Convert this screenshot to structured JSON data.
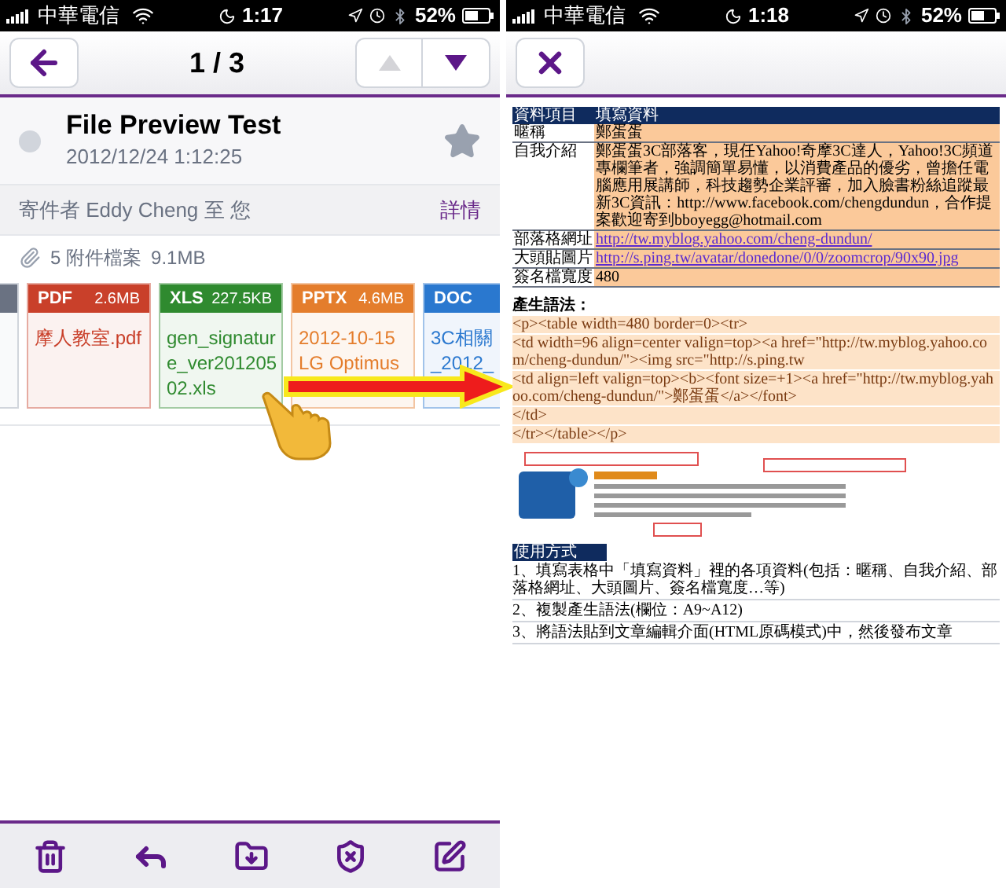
{
  "left_screen": {
    "status_bar": {
      "carrier": "中華電信",
      "time": "1:17",
      "battery": "52%"
    },
    "nav": {
      "counter": "1 / 3",
      "prev_disabled": true,
      "next_disabled": false
    },
    "message": {
      "subject": "File Preview Test",
      "date": "2012/12/24 1:12:25",
      "read": true,
      "starred": false
    },
    "sender_line": "寄件者 Eddy Cheng 至 您",
    "details_link": "詳情",
    "attachments": {
      "summary": "5 附件檔案",
      "size": "9.1MB",
      "items": [
        {
          "type": "PDF",
          "size": "2.6MB",
          "name_lines": [
            "摩人教室.pdf"
          ],
          "color": "#c9402a"
        },
        {
          "type": "XLS",
          "size": "227.5KB",
          "name_lines": [
            "gen_signatur",
            "e_ver201205",
            "02.xls"
          ],
          "color": "#2f8a2f"
        },
        {
          "type": "PPTX",
          "size": "4.6MB",
          "name_lines": [
            "2012-10-15",
            "LG Optimus"
          ],
          "color": "#e47d2c"
        },
        {
          "type": "DOC",
          "name_lines": [
            "3C相關",
            "_2012_"
          ],
          "color": "#2a78cf"
        }
      ]
    }
  },
  "right_screen": {
    "status_bar": {
      "carrier": "中華電信",
      "time": "1:18",
      "battery": "52%"
    },
    "sheet": {
      "header": [
        "資料項目",
        "填寫資料"
      ],
      "rows": [
        {
          "label": "暱稱",
          "value": "鄭蛋蛋",
          "kind": "text"
        },
        {
          "label": "自我介紹",
          "value": "鄭蛋蛋3C部落客，現任Yahoo!奇摩3C達人，Yahoo!3C頻道專欄筆者，強調簡單易懂，以消費產品的優劣，曾擔任電腦應用展講師，科技趨勢企業評審，加入臉書粉絲追蹤最新3C資訊：http://www.facebook.com/chengdundun，合作提案歡迎寄到bboyegg@hotmail.com",
          "kind": "text"
        },
        {
          "label": "部落格網址",
          "value": "http://tw.myblog.yahoo.com/cheng-dundun/",
          "kind": "link"
        },
        {
          "label": "大頭貼圖片",
          "value": "http://s.ping.tw/avatar/donedone/0/0/zoomcrop/90x90.jpg",
          "kind": "link"
        },
        {
          "label": "簽名檔寬度",
          "value": "480",
          "kind": "text"
        }
      ],
      "code_title": "產生語法：",
      "code_lines": [
        "<p><table width=480 border=0><tr>",
        "<td width=96 align=center valign=top><a href=\"http://tw.myblog.yahoo.com/cheng-dundun/\"><img src=\"http://s.ping.tw",
        "<td align=left valign=top><b><font size=+1><a href=\"http://tw.myblog.yahoo.com/cheng-dundun/\">鄭蛋蛋</a></font>",
        "</td>",
        "</tr></table></p>"
      ],
      "usage_title": "使用方式",
      "usage_lines": [
        "1、填寫表格中「填寫資料」裡的各項資料(包括：暱稱、自我介紹、部落格網址、大頭圖片、簽名檔寬度…等)",
        "2、複製產生語法(欄位：A9~A12)",
        "3、將語法貼到文章編輯介面(HTML原碼模式)中，然後發布文章"
      ]
    }
  }
}
